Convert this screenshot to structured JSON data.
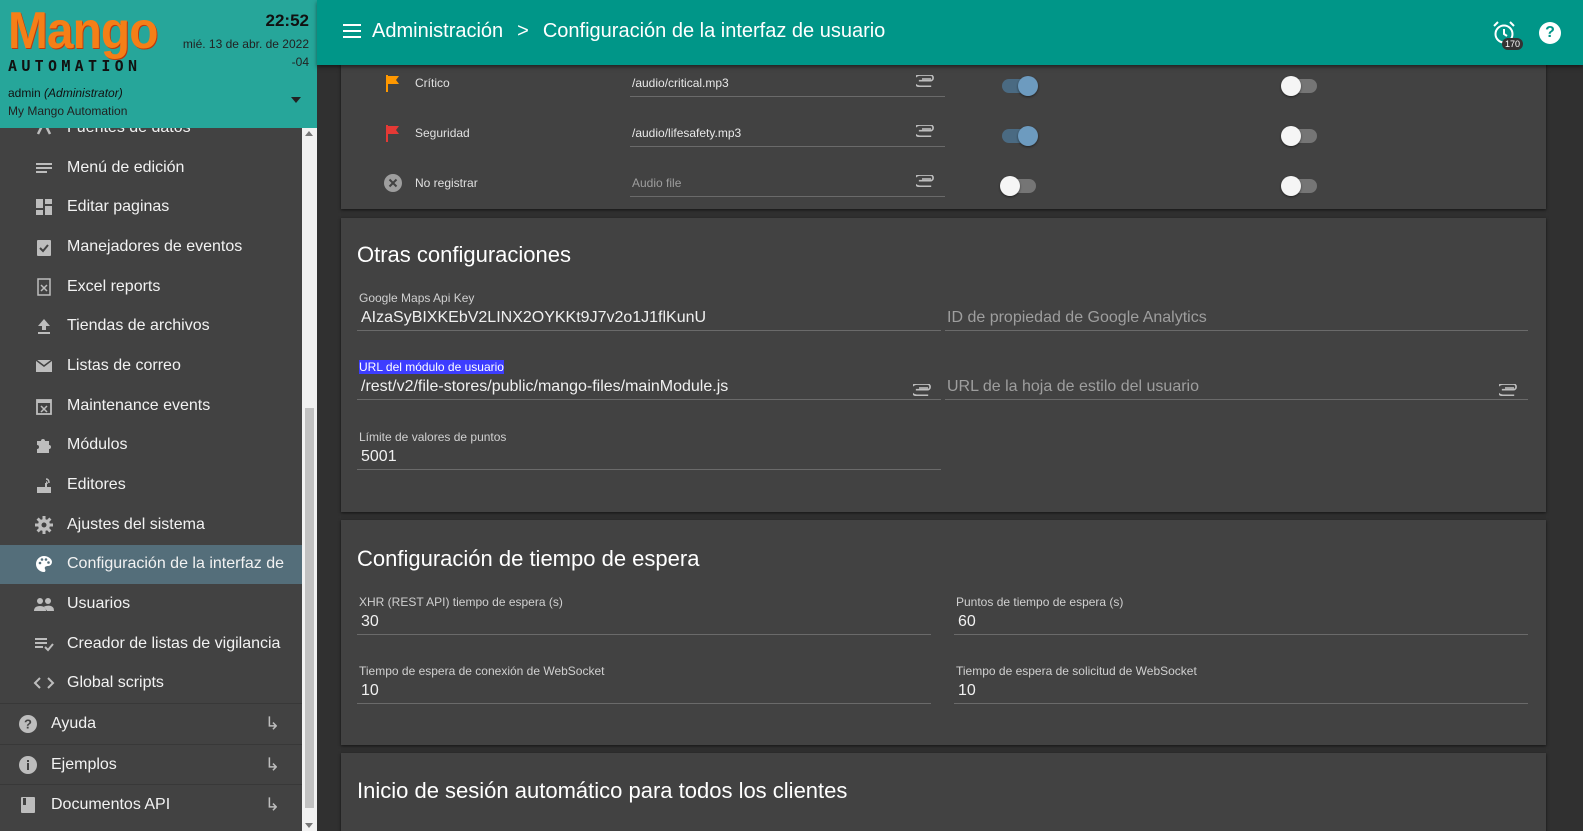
{
  "brand": {
    "logo_main": "Mango",
    "logo_sub": "AUTOMATION",
    "time": "22:52",
    "date_line1": "mié. 13 de abr. de 2022",
    "date_line2": "-04",
    "user": "admin",
    "role": "(Administrator)",
    "org": "My Mango Automation"
  },
  "sidebar": {
    "items": [
      {
        "label": "Fuentes de datos",
        "icon": "datasource-icon"
      },
      {
        "label": "Menú de edición",
        "icon": "menu-edit-icon"
      },
      {
        "label": "Editar paginas",
        "icon": "dashboard-icon"
      },
      {
        "label": "Manejadores de eventos",
        "icon": "assignment-check-icon"
      },
      {
        "label": "Excel reports",
        "icon": "excel-icon"
      },
      {
        "label": "Tiendas de archivos",
        "icon": "upload-icon"
      },
      {
        "label": "Listas de correo",
        "icon": "mail-icon"
      },
      {
        "label": "Maintenance events",
        "icon": "calendar-x-icon"
      },
      {
        "label": "Módulos",
        "icon": "puzzle-icon"
      },
      {
        "label": "Editores",
        "icon": "router-icon"
      },
      {
        "label": "Ajustes del sistema",
        "icon": "gear-icon"
      },
      {
        "label": "Configuración de la interfaz de",
        "icon": "palette-icon",
        "active": true
      },
      {
        "label": "Usuarios",
        "icon": "people-icon"
      },
      {
        "label": "Creador de listas de vigilancia",
        "icon": "playlist-check-icon"
      },
      {
        "label": "Global scripts",
        "icon": "code-icon"
      }
    ],
    "top_items": [
      {
        "label": "Ayuda",
        "icon": "help-icon"
      },
      {
        "label": "Ejemplos",
        "icon": "info-icon"
      },
      {
        "label": "Documentos API",
        "icon": "book-icon"
      }
    ]
  },
  "topbar": {
    "crumb1": "Administración",
    "crumb_sep": ">",
    "crumb2": "Configuración de la interfaz de usuario",
    "alarm_count": "170"
  },
  "alarm_sounds": [
    {
      "name": "Crítico",
      "file": "/audio/critical.mp3",
      "placeholder": "",
      "toggle1": true,
      "toggle2": false,
      "icon": "flag-orange-icon"
    },
    {
      "name": "Seguridad",
      "file": "/audio/lifesafety.mp3",
      "placeholder": "",
      "toggle1": true,
      "toggle2": false,
      "icon": "flag-red-icon"
    },
    {
      "name": "No registrar",
      "file": "",
      "placeholder": "Audio file",
      "toggle1": false,
      "toggle2": false,
      "icon": "cancel-circle-icon"
    }
  ],
  "other_settings": {
    "title": "Otras configuraciones",
    "gmaps_label": "Google Maps Api Key",
    "gmaps_value": "AIzaSyBIXKEbV2LINX2OYKKt9J7v2o1J1flKunU",
    "ga_placeholder": "ID de propiedad de Google Analytics",
    "module_label": "URL del módulo de usuario",
    "module_value": "/rest/v2/file-stores/public/mango-files/mainModule.js",
    "stylesheet_placeholder": "URL de la hoja de estilo del usuario",
    "limit_label": "Límite de valores de puntos",
    "limit_value": "5001"
  },
  "timeout_settings": {
    "title": "Configuración de tiempo de espera",
    "xhr_label": "XHR (REST API) tiempo de espera (s)",
    "xhr_value": "30",
    "points_label": "Puntos de tiempo de espera (s)",
    "points_value": "60",
    "ws_conn_label": "Tiempo de espera de conexión de WebSocket",
    "ws_conn_value": "10",
    "ws_req_label": "Tiempo de espera de solicitud de WebSocket",
    "ws_req_value": "10"
  },
  "autologin": {
    "title": "Inicio de sesión automático para todos los clientes"
  },
  "colors": {
    "teal": "#009688",
    "teal_light": "#26a69a",
    "active_item": "#546e7a",
    "card": "#424242",
    "orange_logo": "#f57f17"
  }
}
